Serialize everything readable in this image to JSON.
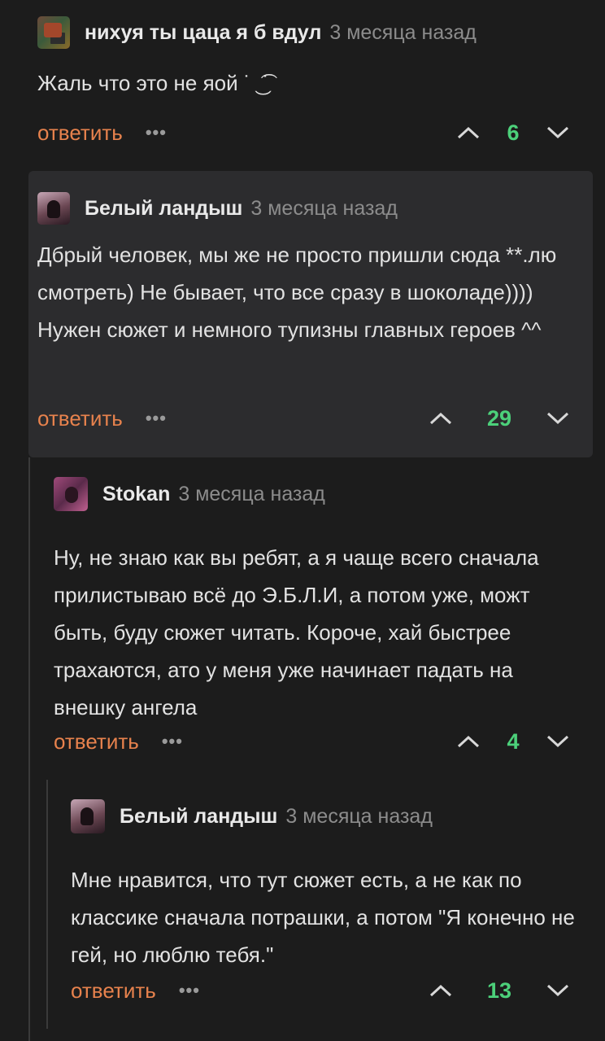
{
  "comments": [
    {
      "author": "нихуя ты цаца я б вдул",
      "time": "3 месяца назад",
      "text": "Жаль что это не яой ˙ ͜ ͡˙",
      "reply": "ответить",
      "more": "•••",
      "score": "6"
    },
    {
      "author": "Белый ландыш",
      "time": "3 месяца назад",
      "text": "Дбрый человек, мы же не просто пришли сюда **.лю смотреть) Не бывает, что все сразу в шоколаде)))) Нужен сюжет и немного тупизны главных героев ^^",
      "reply": "ответить",
      "more": "•••",
      "score": "29"
    },
    {
      "author": "Stokan",
      "time": "3 месяца назад",
      "text": "Ну, не знаю как вы ребят, а я чаще всего сначала прилистываю всё до Э.Б.Л.И, а потом уже, можт быть, буду сюжет читать. Короче, хай быстрее трахаются, ато у меня уже начинает падать на внешку ангела",
      "reply": "ответить",
      "more": "•••",
      "score": "4"
    },
    {
      "author": "Белый ландыш",
      "time": "3 месяца назад",
      "text": "Мне нравится, что тут сюжет есть, а не как по классике сначала потрашки, а потом \"Я конечно не гей, но люблю тебя.\"",
      "reply": "ответить",
      "more": "•••",
      "score": "13"
    }
  ],
  "colors": {
    "background": "#1c1c1c",
    "highlight": "#2c2c2e",
    "reply": "#e7824d",
    "score": "#4cd07a"
  }
}
